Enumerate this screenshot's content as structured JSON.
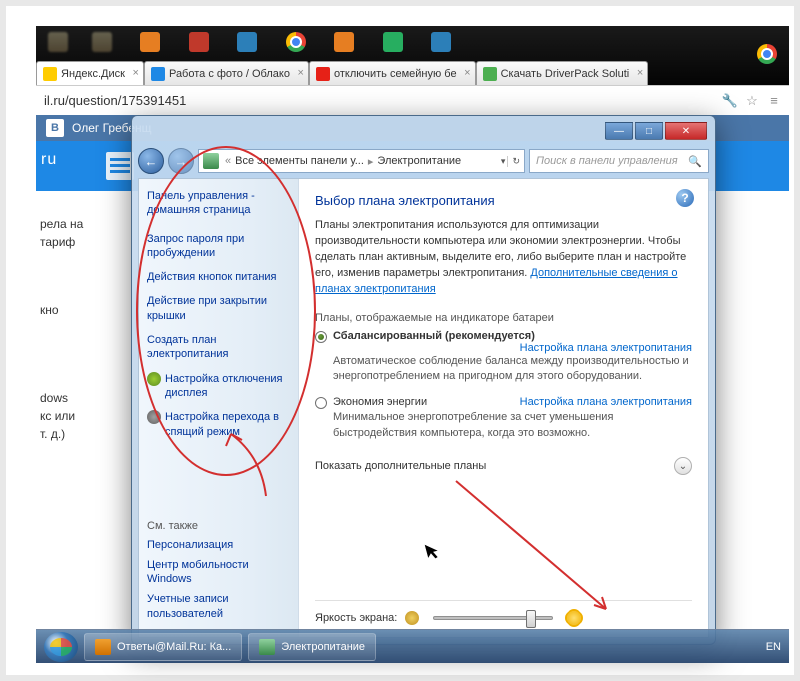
{
  "browser": {
    "tabs": [
      {
        "label": "Яндекс.Диск"
      },
      {
        "label": "Работа с фото / Облако"
      },
      {
        "label": "отключить семейную бе"
      },
      {
        "label": "Скачать DriverPack Soluti"
      }
    ],
    "address": "il.ru/question/175391451"
  },
  "vk_user": "Олег Гребенщ",
  "left_fragments": {
    "f1a": "рела на",
    "f1b": "тариф",
    "f2": "кно",
    "f3a": "dows",
    "f3b": "кс или",
    "f3c": "т. д.)"
  },
  "window": {
    "breadcrumb": {
      "root_tip": "Все элементы панели у...",
      "current": "Электропитание"
    },
    "search_placeholder": "Поиск в панели управления",
    "sidebar": {
      "home": "Панель управления - домашняя страница",
      "items": [
        "Запрос пароля при пробуждении",
        "Действия кнопок питания",
        "Действие при закрытии крышки",
        "Создать план электропитания",
        "Настройка отключения дисплея",
        "Настройка перехода в спящий режим"
      ],
      "see_also_header": "См. также",
      "see_also": [
        "Персонализация",
        "Центр мобильности Windows",
        "Учетные записи пользователей"
      ]
    },
    "content": {
      "title": "Выбор плана электропитания",
      "description": "Планы электропитания используются для оптимизации производительности компьютера или экономии электроэнергии. Чтобы сделать план активным, выделите его, либо выберите план и настройте его, изменив параметры электропитания.",
      "more_link": "Дополнительные сведения о планах электропитания",
      "group_label": "Планы, отображаемые на индикаторе батареи",
      "plan1": {
        "name": "Сбалансированный (рекомендуется)",
        "config": "Настройка плана электропитания",
        "sub": "Автоматическое соблюдение баланса между производительностью и энергопотреблением на пригодном для этого оборудовании."
      },
      "plan2": {
        "name": "Экономия энергии",
        "config": "Настройка плана электропитания",
        "sub": "Минимальное энергопотребление за счет уменьшения быстродействия компьютера, когда это возможно."
      },
      "show_more": "Показать дополнительные планы",
      "brightness_label": "Яркость экрана:"
    }
  },
  "taskbar": {
    "btn1": "Ответы@Mail.Ru: Ка...",
    "btn2": "Электропитание",
    "lang": "EN"
  }
}
